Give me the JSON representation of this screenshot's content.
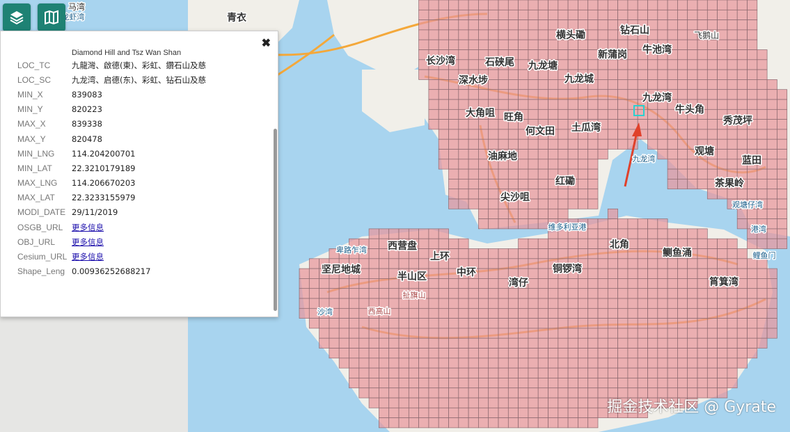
{
  "toolbar": {
    "layers_icon": "layers-icon",
    "basemap_icon": "map-icon",
    "accent": "#1e8274"
  },
  "popup": {
    "truncated_top": "Diamond Hill and Tsz Wan Shan",
    "close_glyph": "✖",
    "fields": [
      {
        "key": "LOC_TC",
        "value": "九龍灣、啟德(東)、彩虹、鑽石山及慈"
      },
      {
        "key": "LOC_SC",
        "value": "九龙湾、启德(东)、彩虹、钻石山及慈"
      },
      {
        "key": "MIN_X",
        "value": "839083"
      },
      {
        "key": "MIN_Y",
        "value": "820223"
      },
      {
        "key": "MAX_X",
        "value": "839338"
      },
      {
        "key": "MAX_Y",
        "value": "820478"
      },
      {
        "key": "MIN_LNG",
        "value": "114.204200701"
      },
      {
        "key": "MIN_LAT",
        "value": "22.3210179189"
      },
      {
        "key": "MAX_LNG",
        "value": "114.206670203"
      },
      {
        "key": "MAX_LAT",
        "value": "22.3233155979"
      },
      {
        "key": "MODI_DATE",
        "value": "29/11/2019"
      },
      {
        "key": "OSGB_URL",
        "value": "更多信息",
        "link": true
      },
      {
        "key": "OBJ_URL",
        "value": "更多信息",
        "link": true
      },
      {
        "key": "Cesium_URL",
        "value": "更多信息",
        "link": true
      },
      {
        "key": "Shape_Leng",
        "value": "0.00936252688217"
      }
    ]
  },
  "map": {
    "colors": {
      "water": "#a8d4ef",
      "land": "#f1efe9",
      "grid_fill": "#e9959b",
      "grid_stroke": "#8c6a70",
      "highlight": "#2ad0d0",
      "arrow": "#e0412b",
      "road": "#f4a83a"
    },
    "labels": [
      {
        "text": "马湾"
      },
      {
        "text": "龙虾湾"
      },
      {
        "text": "青衣"
      },
      {
        "text": "横头磡"
      },
      {
        "text": "钻石山"
      },
      {
        "text": "飞鹅山"
      },
      {
        "text": "长沙湾"
      },
      {
        "text": "石硖尾"
      },
      {
        "text": "九龙塘"
      },
      {
        "text": "新蒲岗"
      },
      {
        "text": "牛池湾"
      },
      {
        "text": "深水埗"
      },
      {
        "text": "九龙城"
      },
      {
        "text": "九龙湾"
      },
      {
        "text": "大角咀"
      },
      {
        "text": "旺角"
      },
      {
        "text": "何文田"
      },
      {
        "text": "土瓜湾"
      },
      {
        "text": "牛头角"
      },
      {
        "text": "秀茂坪"
      },
      {
        "text": "油麻地"
      },
      {
        "text": "九龙湾"
      },
      {
        "text": "观塘"
      },
      {
        "text": "蓝田"
      },
      {
        "text": "红磡"
      },
      {
        "text": "茶果岭"
      },
      {
        "text": "尖沙咀"
      },
      {
        "text": "观塘仔湾"
      },
      {
        "text": "维多利亚港"
      },
      {
        "text": "港湾"
      },
      {
        "text": "卑路乍湾"
      },
      {
        "text": "西营盘"
      },
      {
        "text": "上环"
      },
      {
        "text": "北角"
      },
      {
        "text": "鲗鱼涌"
      },
      {
        "text": "鲤鱼门"
      },
      {
        "text": "坚尼地城"
      },
      {
        "text": "半山区"
      },
      {
        "text": "中环"
      },
      {
        "text": "铜锣湾"
      },
      {
        "text": "湾仔"
      },
      {
        "text": "筲箕湾"
      },
      {
        "text": "扯旗山"
      },
      {
        "text": "沙湾"
      },
      {
        "text": "西高山"
      }
    ]
  },
  "watermark": "掘金技术社区 @ Gyrate"
}
